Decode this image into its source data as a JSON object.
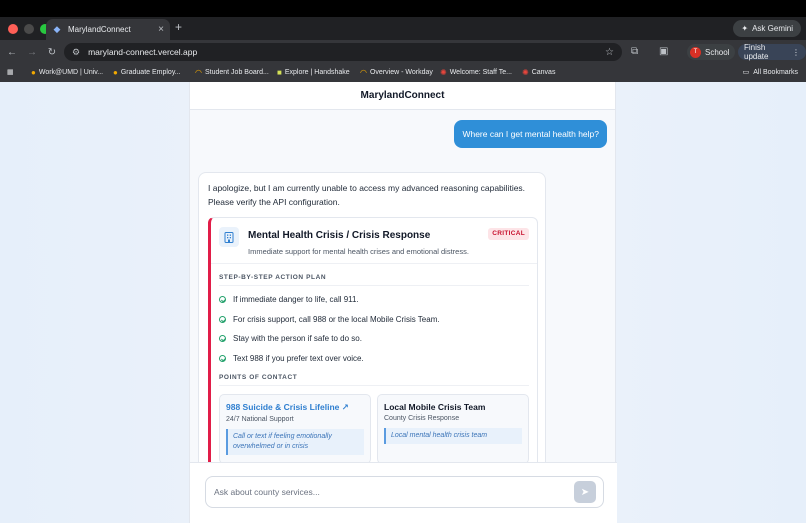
{
  "browser": {
    "tab_title": "MarylandConnect",
    "tab_close": "×",
    "new_tab": "+",
    "gemini_label": "Ask Gemini",
    "url": "maryland-connect.vercel.app",
    "profile_initial": "T",
    "profile_label": "School",
    "finish_update": "Finish update",
    "bookmarks": [
      {
        "label": "Work@UMD | Univ...",
        "icon": "umd-logo-icon"
      },
      {
        "label": "Graduate Employ...",
        "icon": "umd-logo-icon"
      },
      {
        "label": "Student Job Board...",
        "icon": "workday-icon"
      },
      {
        "label": "Explore | Handshake",
        "icon": "handshake-icon"
      },
      {
        "label": "Overview - Workday",
        "icon": "workday-icon"
      },
      {
        "label": "Welcome: Staff Te...",
        "icon": "gear-icon"
      },
      {
        "label": "Canvas",
        "icon": "canvas-icon"
      }
    ],
    "all_bookmarks": "All Bookmarks"
  },
  "app": {
    "title": "MarylandConnect",
    "user_message": "Where can I get mental health help?",
    "bot_intro": "I apologize, but I am currently unable to access my advanced reasoning capabilities. Please verify the API configuration.",
    "card": {
      "icon": "building-icon",
      "title": "Mental Health Crisis / Crisis Response",
      "subtitle": "Immediate support for mental health crises and emotional distress.",
      "badge": "CRITICAL",
      "steps_heading": "STEP-BY-STEP ACTION PLAN",
      "steps": [
        "If immediate danger to life, call 911.",
        "For crisis support, call 988 or the local Mobile Crisis Team.",
        "Stay with the person if safe to do so.",
        "Text 988 if you prefer text over voice."
      ],
      "contacts_heading": "POINTS OF CONTACT",
      "contacts": [
        {
          "name": "988 Suicide & Crisis Lifeline",
          "sub": "24/7 National Support",
          "note": "Call or text if feeling emotionally overwhelmed or in crisis"
        },
        {
          "name": "Local Mobile Crisis Team",
          "sub": "County Crisis Response",
          "note": "Local mental health crisis team"
        }
      ]
    },
    "input_placeholder": "Ask about county services..."
  },
  "colors": {
    "accent": "#2f8fd8",
    "critical": "#e11d48",
    "link": "#2f7fd0"
  }
}
